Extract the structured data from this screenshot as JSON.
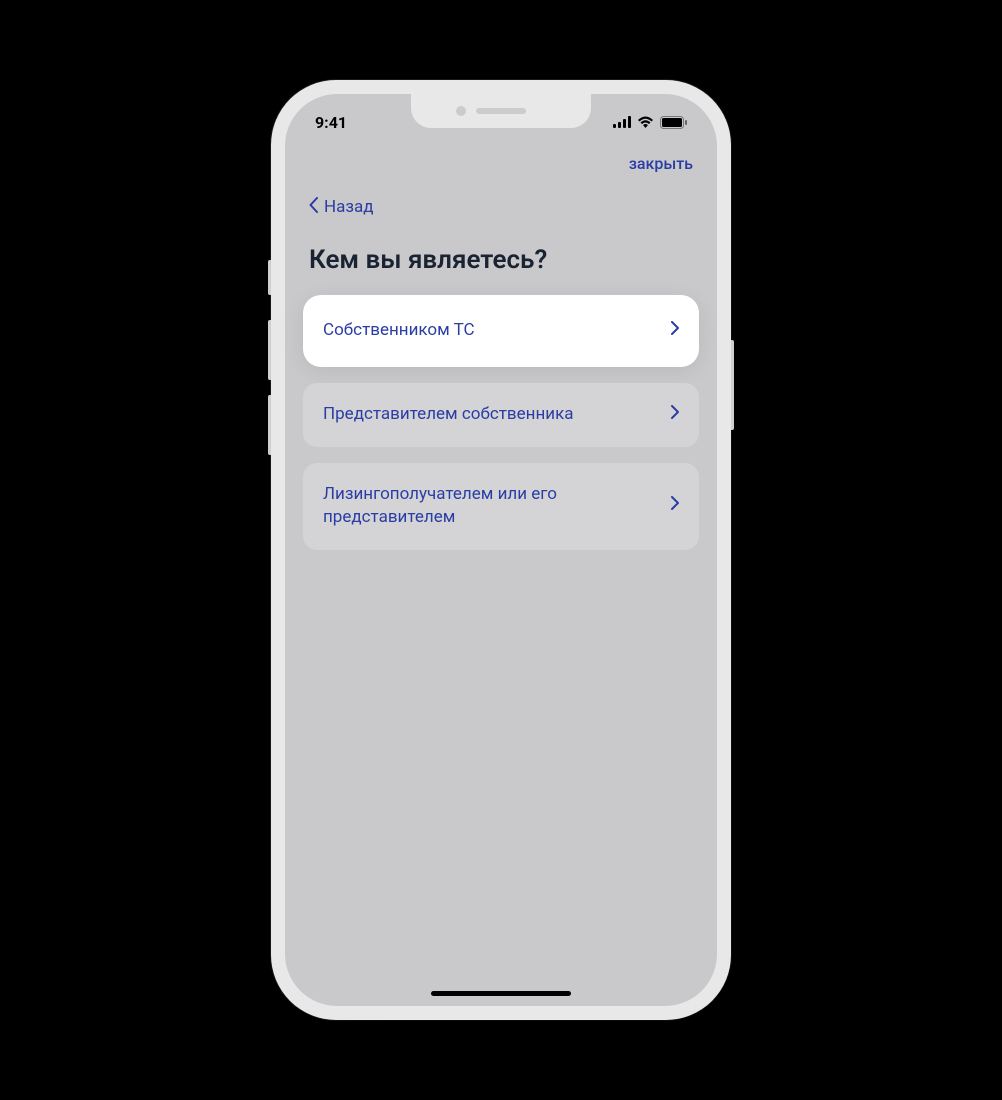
{
  "status": {
    "time": "9:41"
  },
  "header": {
    "close_label": "закрыть"
  },
  "back": {
    "label": "Назад"
  },
  "title": "Кем вы являетесь?",
  "options": [
    {
      "label": "Собственником ТС",
      "selected": true
    },
    {
      "label": "Представителем собственника",
      "selected": false
    },
    {
      "label": "Лизингополучателем или его представителем",
      "selected": false
    }
  ]
}
